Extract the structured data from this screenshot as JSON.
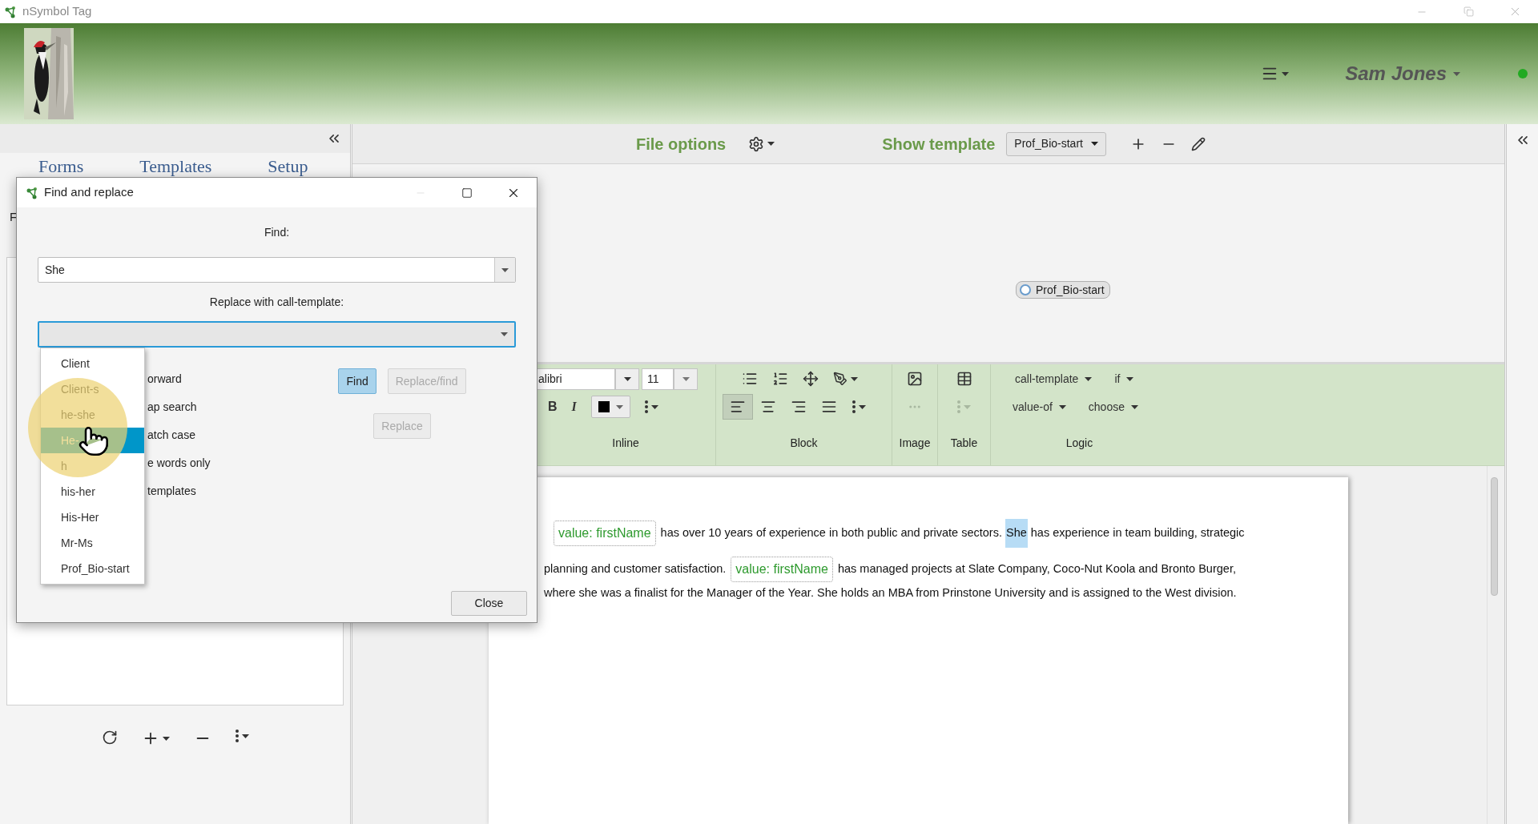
{
  "window": {
    "title": "nSymbol Tag"
  },
  "header": {
    "user": "Sam Jones",
    "online": true
  },
  "left_panel": {
    "tabs": [
      {
        "label": "Forms",
        "selected": false
      },
      {
        "label": "Templates",
        "selected": false
      },
      {
        "label": "Setup",
        "selected": false
      }
    ],
    "partial_label": "F"
  },
  "main": {
    "toolbar": {
      "file_options": "File options",
      "show_template": "Show template",
      "template": "Prof_Bio-start"
    },
    "canvas": {
      "node": "Prof_Bio-start",
      "node_selected": false
    },
    "ribbon": {
      "font": "alibri",
      "size": "11",
      "bold": "B",
      "italic": "I",
      "align": [
        {
          "kind": "left",
          "selected": true
        },
        {
          "kind": "center",
          "selected": false
        },
        {
          "kind": "right",
          "selected": false
        },
        {
          "kind": "justify",
          "selected": false
        }
      ],
      "image_more_disabled": true,
      "table_more_disabled": true,
      "logic": [
        {
          "label": "call-template"
        },
        {
          "label": "if"
        },
        {
          "label": "value-of"
        },
        {
          "label": "choose"
        }
      ],
      "groups": [
        "Inline",
        "Block",
        "Image",
        "Table",
        "Logic"
      ]
    },
    "document": {
      "lines": [
        [
          {
            "kind": "chip",
            "text": "value: firstName"
          },
          {
            "kind": "text",
            "text": "has over 10 years of experience in both public and private sectors."
          },
          {
            "kind": "highlight",
            "text": "She"
          },
          {
            "kind": "text",
            "text": "has experience in team building, strategic"
          }
        ],
        [
          {
            "kind": "text",
            "text": "planning and customer satisfaction."
          },
          {
            "kind": "chip",
            "text": "value: firstName"
          },
          {
            "kind": "text",
            "text": "has managed projects at Slate Company, Coco-Nut Koola and Bronto Burger,"
          }
        ],
        [
          {
            "kind": "text",
            "text": "where she was a finalist for the Manager of the Year. She holds an MBA from Prinstone University and is assigned to the West division."
          }
        ]
      ]
    }
  },
  "dialog": {
    "title": "Find and replace",
    "find_label": "Find:",
    "find_value": "She",
    "replace_label": "Replace with call-template:",
    "options": [
      "orward",
      "ap search",
      "atch case",
      "e words only",
      "templates"
    ],
    "buttons": [
      {
        "label": "Find",
        "kind": "primary",
        "disabled": false
      },
      {
        "label": "Replace/find",
        "kind": "normal",
        "disabled": true
      },
      {
        "label": "Replace",
        "kind": "normal",
        "disabled": true
      }
    ],
    "close": "Close",
    "dropdown": [
      {
        "label": "Client",
        "selected": false
      },
      {
        "label": "Client-s",
        "selected": false
      },
      {
        "label": "he-she",
        "selected": false
      },
      {
        "label": "He-",
        "selected": true
      },
      {
        "label": "h",
        "selected": false
      },
      {
        "label": "his-her",
        "selected": false
      },
      {
        "label": "His-Her",
        "selected": false
      },
      {
        "label": "Mr-Ms",
        "selected": false
      },
      {
        "label": "Prof_Bio-start",
        "selected": false
      }
    ]
  }
}
